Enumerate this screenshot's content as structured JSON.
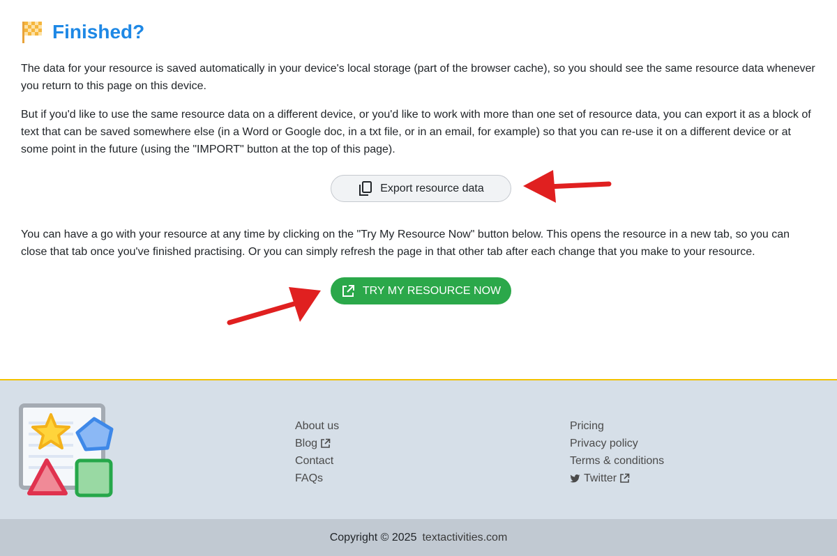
{
  "heading": {
    "title": "Finished?",
    "icon": "checkered-flag-icon",
    "color": "#1e88e5"
  },
  "paragraphs": {
    "p1": "The data for your resource is saved automatically in your device's local storage (part of the browser cache), so you should see the same resource data whenever you return to this page on this device.",
    "p2": "But if you'd like to use the same resource data on a different device, or you'd like to work with more than one set of resource data, you can export it as a block of text that can be saved somewhere else (in a Word or Google doc, in a txt file, or in an email, for example) so that you can re-use it on a different device or at some point in the future (using the \"IMPORT\" button at the top of this page).",
    "p3": "You can have a go with your resource at any time by clicking on the \"Try My Resource Now\" button below. This opens the resource in a new tab, so you can close that tab once you've finished practising. Or you can simply refresh the page in that other tab after each change that you make to your resource."
  },
  "buttons": {
    "export_label": "Export resource data",
    "export_icon": "copy-icon",
    "try_label": "TRY MY RESOURCE NOW",
    "try_icon": "open-external-icon",
    "try_color": "#2ba84a"
  },
  "annotations": {
    "arrow_color": "#e02020"
  },
  "footer": {
    "links_col1": [
      "About us",
      "Blog",
      "Contact",
      "FAQs"
    ],
    "links_col2": [
      "Pricing",
      "Privacy policy",
      "Terms & conditions",
      "Twitter"
    ],
    "background": "#d6dfe8",
    "accent": "#f2c200"
  },
  "copyright": {
    "text": "Copyright © 2025",
    "site": "textactivities.com"
  }
}
